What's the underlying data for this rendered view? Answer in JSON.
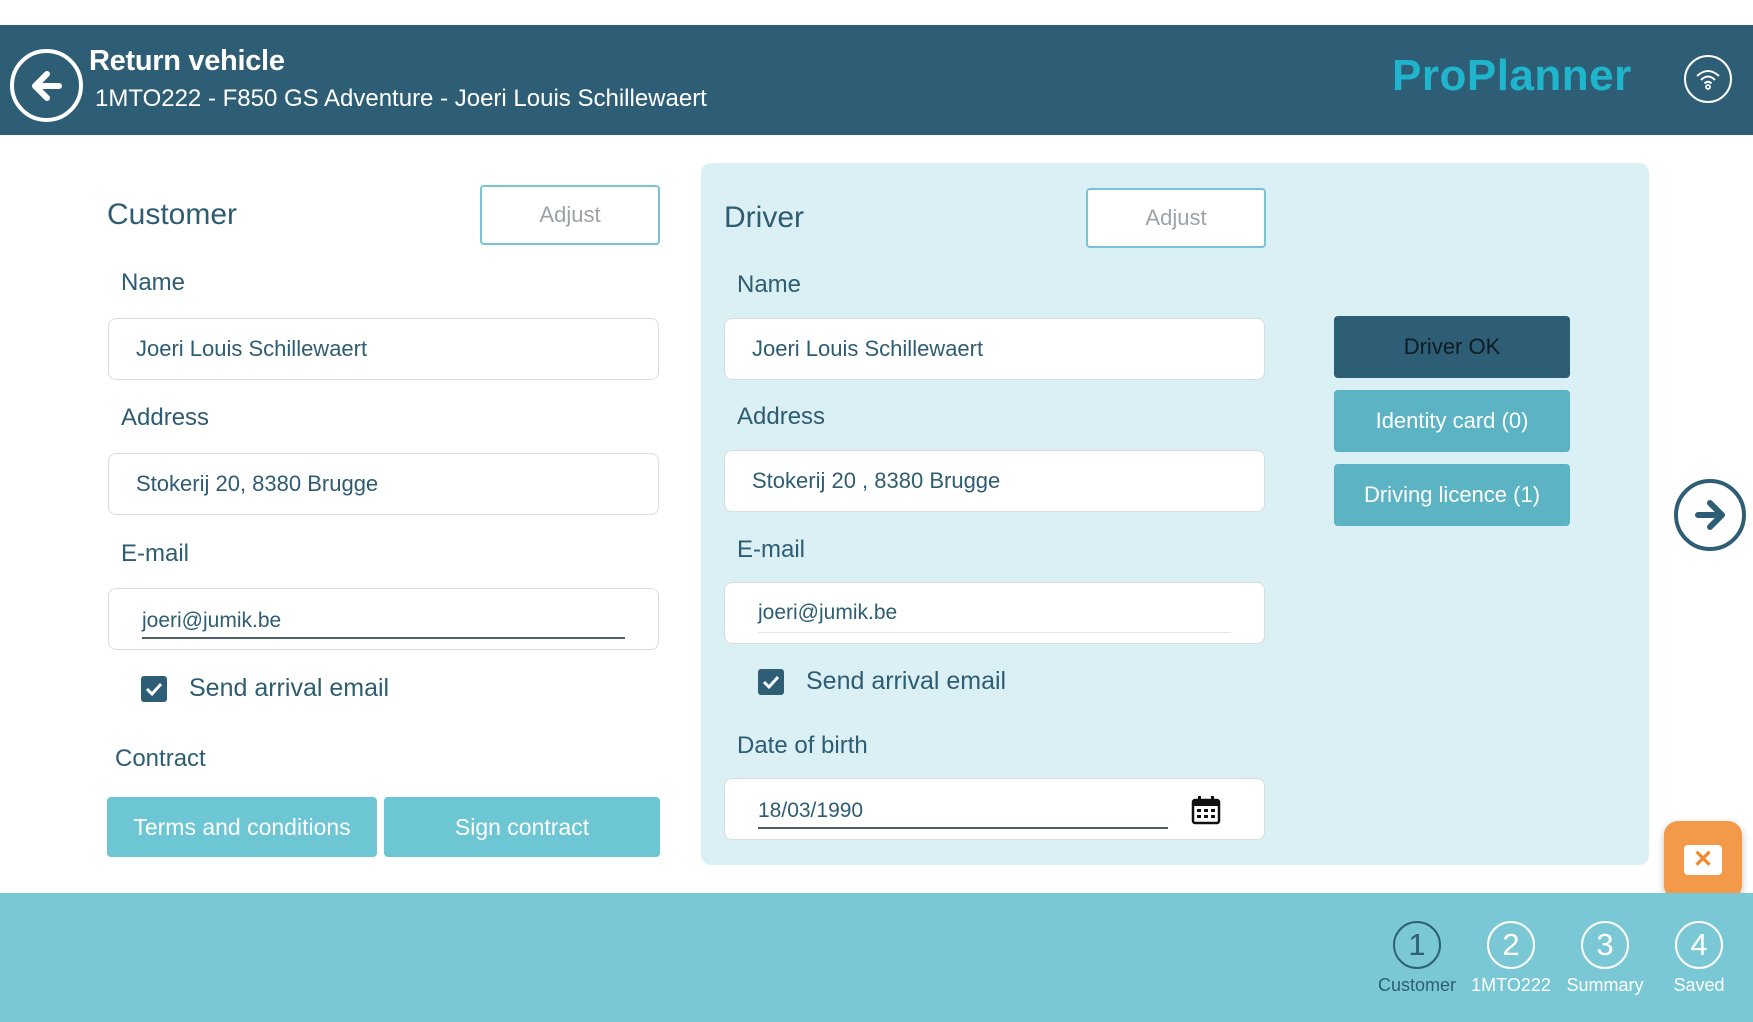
{
  "header": {
    "title": "Return vehicle",
    "subtitle": "1MTO222 - F850 GS Adventure - Joeri Louis Schillewaert",
    "brand": "ProPlanner",
    "back_icon": "arrow-left-circle-icon",
    "connection_icon": "wifi-icon",
    "background_color": "#2e5e76",
    "brand_color": "#1fb5cc"
  },
  "customer": {
    "title": "Customer",
    "adjust_label": "Adjust",
    "name_label": "Name",
    "name_value": "Joeri Louis Schillewaert",
    "address_label": "Address",
    "address_value": "Stokerij 20, 8380 Brugge",
    "email_label": "E-mail",
    "email_value": "joeri@jumik.be",
    "send_email_label": "Send arrival email",
    "send_email_checked": true,
    "contract_label": "Contract",
    "terms_label": "Terms and conditions",
    "sign_label": "Sign contract"
  },
  "driver": {
    "title": "Driver",
    "adjust_label": "Adjust",
    "name_label": "Name",
    "name_value": "Joeri Louis Schillewaert",
    "address_label": "Address",
    "address_value": "Stokerij 20 , 8380 Brugge",
    "email_label": "E-mail",
    "email_value": "joeri@jumik.be",
    "send_email_label": "Send arrival email",
    "send_email_checked": true,
    "dob_label": "Date of birth",
    "dob_value": "18/03/1990",
    "calendar_icon": "calendar-icon",
    "panel_color": "#daf0f4",
    "side_buttons": {
      "driver_ok": "Driver OK",
      "identity_card": "Identity card (0)",
      "driving_licence": "Driving licence (1)"
    }
  },
  "navigation": {
    "next_icon": "arrow-right-circle-icon",
    "close_icon": "close-icon"
  },
  "steps": [
    {
      "number": "1",
      "label": "Customer",
      "active": true
    },
    {
      "number": "2",
      "label": "1MTO222",
      "active": false
    },
    {
      "number": "3",
      "label": "Summary",
      "active": false
    },
    {
      "number": "4",
      "label": "Saved",
      "active": false
    }
  ],
  "colors": {
    "footer": "#7ac8d5",
    "teal_button": "#6cc6d3",
    "fab": "#f39a4a"
  }
}
